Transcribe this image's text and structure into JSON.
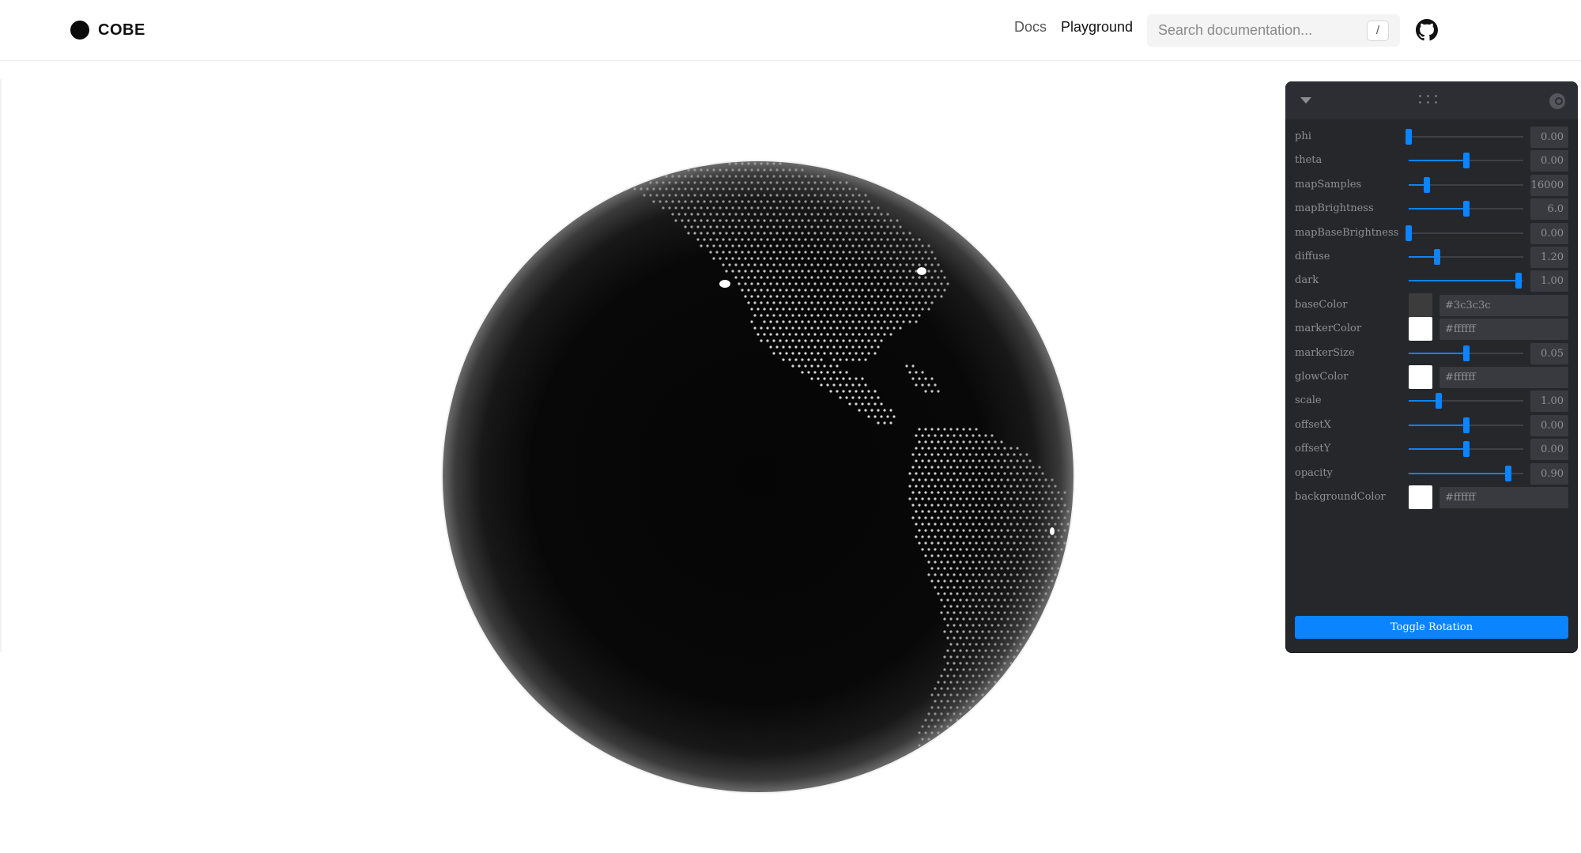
{
  "brand": {
    "name": "COBE"
  },
  "nav": {
    "docs": "Docs",
    "playground": "Playground"
  },
  "search": {
    "placeholder": "Search documentation...",
    "shortcut": "/"
  },
  "icons": {
    "github": "github-icon",
    "panel_toggle": "caret-down-icon",
    "panel_drag": "drag-handle-icon",
    "panel_search": "search-icon"
  },
  "panel": {
    "params": [
      {
        "label": "phi",
        "type": "slider",
        "value": "0.00",
        "fraction": 0.0
      },
      {
        "label": "theta",
        "type": "slider",
        "value": "0.00",
        "fraction": 0.5
      },
      {
        "label": "mapSamples",
        "type": "slider",
        "value": "16000",
        "fraction": 0.16
      },
      {
        "label": "mapBrightness",
        "type": "slider",
        "value": "6.0",
        "fraction": 0.5
      },
      {
        "label": "mapBaseBrightness",
        "type": "slider",
        "value": "0.00",
        "fraction": 0.0
      },
      {
        "label": "diffuse",
        "type": "slider",
        "value": "1.20",
        "fraction": 0.25
      },
      {
        "label": "dark",
        "type": "slider",
        "value": "1.00",
        "fraction": 0.96
      },
      {
        "label": "baseColor",
        "type": "color",
        "value": "#3c3c3c",
        "swatch": "#3c3c3c"
      },
      {
        "label": "markerColor",
        "type": "color",
        "value": "#ffffff",
        "swatch": "#ffffff"
      },
      {
        "label": "markerSize",
        "type": "slider",
        "value": "0.05",
        "fraction": 0.5
      },
      {
        "label": "glowColor",
        "type": "color",
        "value": "#ffffff",
        "swatch": "#ffffff"
      },
      {
        "label": "scale",
        "type": "slider",
        "value": "1.00",
        "fraction": 0.26
      },
      {
        "label": "offsetX",
        "type": "slider",
        "value": "0.00",
        "fraction": 0.5
      },
      {
        "label": "offsetY",
        "type": "slider",
        "value": "0.00",
        "fraction": 0.5
      },
      {
        "label": "opacity",
        "type": "slider",
        "value": "0.90",
        "fraction": 0.87
      },
      {
        "label": "backgroundColor",
        "type": "color",
        "value": "#ffffff",
        "swatch": "#ffffff"
      }
    ],
    "toggle_label": "Toggle Rotation"
  },
  "colors": {
    "accent": "#0a84ff",
    "panel_bg": "#26272b",
    "globe": "#060606"
  }
}
